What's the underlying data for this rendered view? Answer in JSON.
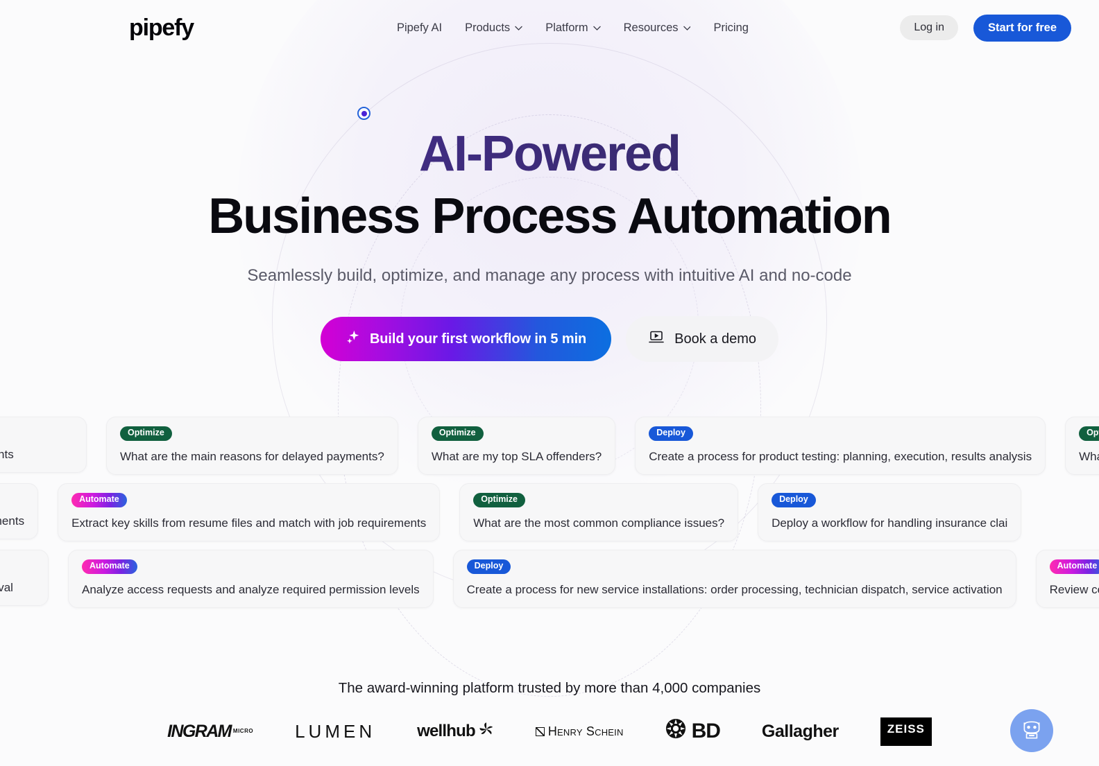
{
  "brand": {
    "logo_text": "pipefy"
  },
  "nav": {
    "items": [
      {
        "label": "Pipefy AI",
        "has_dropdown": false
      },
      {
        "label": "Products",
        "has_dropdown": true
      },
      {
        "label": "Platform",
        "has_dropdown": true
      },
      {
        "label": "Resources",
        "has_dropdown": true
      },
      {
        "label": "Pricing",
        "has_dropdown": false
      }
    ],
    "login_label": "Log in",
    "start_label": "Start for free",
    "start_color": "#1858d8"
  },
  "hero": {
    "title_line1": "AI-Powered",
    "title_line2": "Business Process Automation",
    "subtitle": "Seamlessly build, optimize, and manage any process with intuitive AI and no-code",
    "cta_primary": "Build your first workflow in 5 min",
    "cta_secondary": "Book a demo",
    "gradient_start": "#d400d4",
    "gradient_end": "#0c6fe0"
  },
  "cards": {
    "badge_colors": {
      "Optimize": "#11603f",
      "Deploy": "#1858d8",
      "Automate": "#ff2bb0"
    },
    "row1": [
      {
        "badge": "",
        "text": "st improvements"
      },
      {
        "badge": "Optimize",
        "text": "What are the main reasons for delayed payments?"
      },
      {
        "badge": "Optimize",
        "text": "What are my top SLA offenders?"
      },
      {
        "badge": "Deploy",
        "text": "Create a process for product testing: planning, execution, results analysis"
      },
      {
        "badge": "Optimize",
        "text": "What are the most common t"
      }
    ],
    "row2": [
      {
        "badge": "",
        "text": "nt feedback and suggest service enhancements"
      },
      {
        "badge": "Automate",
        "text": "Extract key skills from resume files and match with job requirements"
      },
      {
        "badge": "Optimize",
        "text": "What are the most common compliance issues?"
      },
      {
        "badge": "Deploy",
        "text": "Deploy a workflow for handling insurance clai"
      }
    ],
    "row3": [
      {
        "badge": "",
        "text": "oduction, approval"
      },
      {
        "badge": "Automate",
        "text": "Analyze access requests and analyze required permission levels"
      },
      {
        "badge": "Deploy",
        "text": "Create a process for new service installations: order processing, technician dispatch, service activation"
      },
      {
        "badge": "Automate",
        "text": "Review contract files an"
      }
    ]
  },
  "trust": {
    "title": "The award-winning platform trusted by more than 4,000 companies",
    "logos": [
      {
        "name": "Ingram Micro",
        "main": "INGRAM",
        "sub": "MICRO"
      },
      {
        "name": "Lumen",
        "main": "LUMEN"
      },
      {
        "name": "Wellhub",
        "main": "wellhub"
      },
      {
        "name": "Henry Schein",
        "main": "Henry Schein"
      },
      {
        "name": "BD",
        "main": "BD"
      },
      {
        "name": "Gallagher",
        "main": "Gallagher"
      },
      {
        "name": "Zeiss",
        "main": "ZEISS"
      }
    ]
  },
  "chat": {
    "icon": "robot-icon",
    "color": "#7ba2ef"
  }
}
